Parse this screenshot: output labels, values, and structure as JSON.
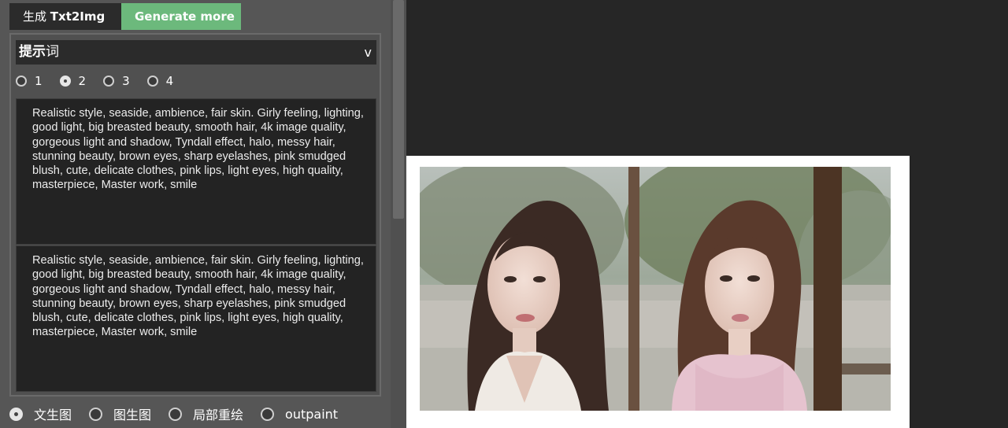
{
  "tabs": {
    "active": {
      "prefix": "生成",
      "label": "Txt2Img"
    },
    "generate_more": "Generate more"
  },
  "prompt": {
    "header_bold": "提示",
    "header_rest": "词",
    "chevron": "v",
    "count_options": [
      "1",
      "2",
      "3",
      "4"
    ],
    "selected_count": "2",
    "textareas": [
      "Realistic style, seaside, ambience, fair skin. Girly feeling, lighting, good light, big breasted beauty, smooth hair, 4k image quality, gorgeous light and shadow, Tyndall effect, halo, messy hair, stunning beauty, brown eyes, sharp eyelashes, pink smudged blush, cute, delicate clothes, pink lips, light eyes, high quality, masterpiece, Master work, smile",
      "Realistic style, seaside, ambience, fair skin. Girly feeling, lighting, good light, big breasted beauty, smooth hair, 4k image quality, gorgeous light and shadow, Tyndall effect, halo, messy hair, stunning beauty, brown eyes, sharp eyelashes, pink smudged blush, cute, delicate clothes, pink lips, light eyes, high quality, masterpiece, Master work, smile"
    ]
  },
  "modes": {
    "options": [
      "文生图",
      "图生图",
      "局部重绘",
      "outpaint"
    ],
    "selected": "文生图"
  },
  "colors": {
    "accent_green": "#6cb97c",
    "panel_bg": "#565656",
    "textarea_bg": "#232323",
    "app_bg": "#262626"
  }
}
